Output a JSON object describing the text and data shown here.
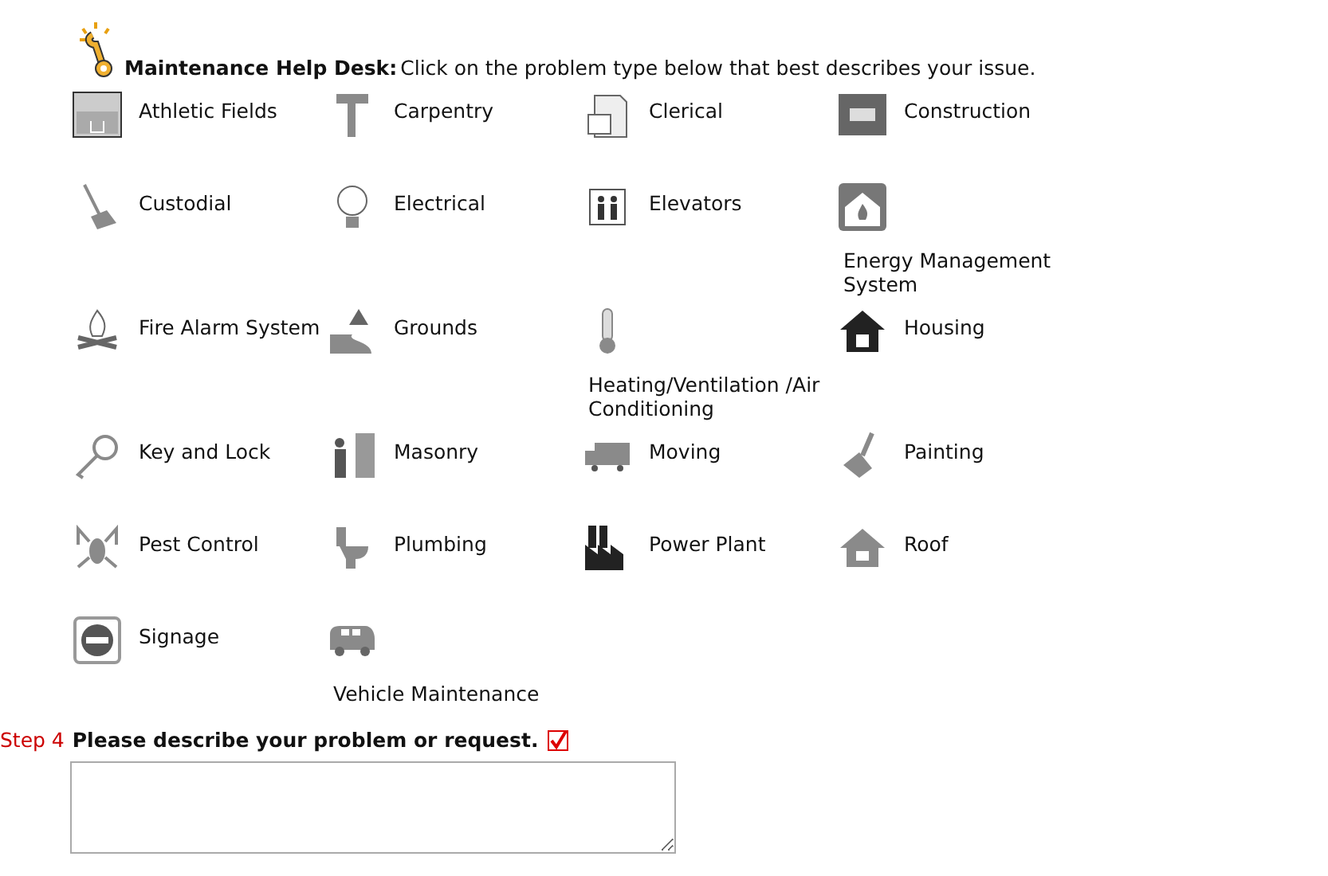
{
  "header": {
    "title": "Maintenance Help Desk:",
    "text": "Click on the problem type below that best describes your issue."
  },
  "problem_types": [
    {
      "label": "Athletic Fields",
      "kind": "inline"
    },
    {
      "label": "Carpentry",
      "kind": "inline"
    },
    {
      "label": "Clerical",
      "kind": "inline"
    },
    {
      "label": "Construction",
      "kind": "inline"
    },
    {
      "label": "Custodial",
      "kind": "inline"
    },
    {
      "label": "Electrical",
      "kind": "inline"
    },
    {
      "label": "Elevators",
      "kind": "inline"
    },
    {
      "label": "Energy Management System",
      "kind": "stacked"
    },
    {
      "label": "Fire Alarm System",
      "kind": "inline"
    },
    {
      "label": "Grounds",
      "kind": "inline"
    },
    {
      "label": "Heating/Ventilation /Air Conditioning",
      "kind": "stacked"
    },
    {
      "label": "Housing",
      "kind": "inline"
    },
    {
      "label": "Key and Lock",
      "kind": "inline"
    },
    {
      "label": "Masonry",
      "kind": "inline"
    },
    {
      "label": "Moving",
      "kind": "inline"
    },
    {
      "label": "Painting",
      "kind": "inline"
    },
    {
      "label": "Pest Control",
      "kind": "inline"
    },
    {
      "label": "Plumbing",
      "kind": "inline"
    },
    {
      "label": "Power Plant",
      "kind": "inline"
    },
    {
      "label": "Roof",
      "kind": "inline"
    },
    {
      "label": "Signage",
      "kind": "inline"
    },
    {
      "label": "Vehicle Maintenance",
      "kind": "stacked"
    }
  ],
  "step": {
    "number": "Step 4",
    "question": "Please describe your problem or request."
  }
}
